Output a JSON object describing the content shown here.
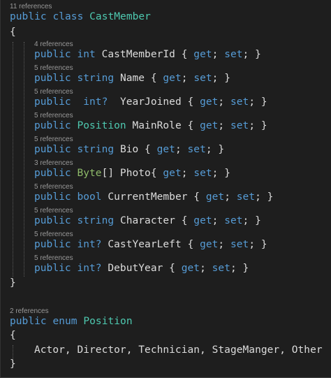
{
  "class_block": {
    "references": "11 references",
    "kw_public": "public",
    "kw_class": "class",
    "name": "CastMember",
    "open_brace": "{",
    "close_brace": "}",
    "properties": [
      {
        "references": "4 references",
        "access": "public",
        "type": "int",
        "type_kind": "keyword",
        "rest": "CastMemberId { get; set; }"
      },
      {
        "references": "5 references",
        "access": "public",
        "type": "string",
        "type_kind": "keyword",
        "rest": "Name { get; set; }"
      },
      {
        "references": "5 references",
        "access": "public",
        "type": "int?",
        "type_kind": "keyword",
        "rest": "YearJoined { get; set; }"
      },
      {
        "references": "5 references",
        "access": "public",
        "type": "Position",
        "type_kind": "class",
        "rest": "MainRole { get; set; }"
      },
      {
        "references": "5 references",
        "access": "public",
        "type": "string",
        "type_kind": "keyword",
        "rest": "Bio { get; set; }"
      },
      {
        "references": "3 references",
        "access": "public",
        "type": "Byte",
        "type_kind": "struct",
        "rest": "[] Photo{ get; set; }"
      },
      {
        "references": "5 references",
        "access": "public",
        "type": "bool",
        "type_kind": "keyword",
        "rest": "CurrentMember { get; set; }"
      },
      {
        "references": "5 references",
        "access": "public",
        "type": "string",
        "type_kind": "keyword",
        "rest": "Character { get; set; }"
      },
      {
        "references": "5 references",
        "access": "public",
        "type": "int?",
        "type_kind": "keyword",
        "rest": "CastYearLeft { get; set; }"
      },
      {
        "references": "5 references",
        "access": "public",
        "type": "int?",
        "type_kind": "keyword",
        "rest": "DebutYear { get; set; }"
      }
    ]
  },
  "enum_block": {
    "references": "2 references",
    "kw_public": "public",
    "kw_enum": "enum",
    "name": "Position",
    "open_brace": "{",
    "values": "Actor, Director, Technician, StageManger, Other",
    "close_brace": "}"
  },
  "colors": {
    "background": "#1e1e1e",
    "keyword": "#569cd6",
    "type_name": "#4ec9b0",
    "struct_name": "#8fbc6a",
    "plain_text": "#dcdcdc",
    "codelens": "#999999"
  }
}
